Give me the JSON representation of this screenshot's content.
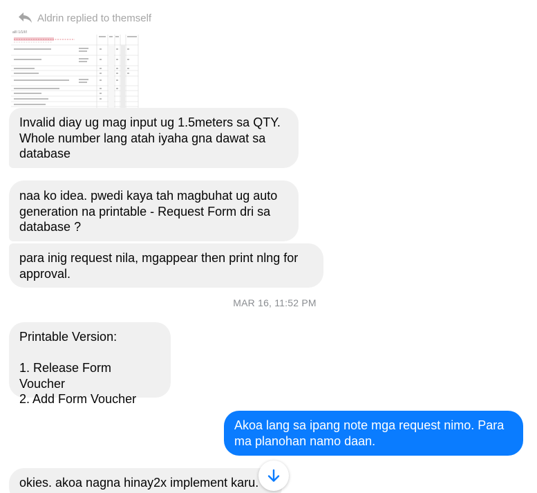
{
  "reply_header": {
    "text": "Aldrin replied to themself",
    "icon": "reply-icon"
  },
  "attachment": {
    "type": "spreadsheet-screenshot",
    "title": "aIII 1/1/I/I"
  },
  "messages": [
    {
      "direction": "incoming",
      "text": "Invalid diay ug mag input ug 1.5meters sa QTY.\nWhole number lang atah iyaha gna dawat sa\ndatabase"
    },
    {
      "direction": "incoming",
      "text": "naa ko idea. pwedi kaya tah magbuhat ug auto\ngeneration na printable - Request Form dri sa\ndatabase ?"
    },
    {
      "direction": "incoming",
      "text": "para inig request nila, mgappear then print nlng for\napproval."
    },
    {
      "direction": "incoming",
      "text": "Printable Version:\n\n1. Release Form Voucher\n2. Add Form Voucher"
    },
    {
      "direction": "outgoing",
      "text": "Akoa lang sa ipang note mga request nimo. Para\nma planohan namo daan."
    },
    {
      "direction": "incoming",
      "text": "okies. akoa nagna hinay2x implement karu."
    }
  ],
  "timestamp": "MAR 16, 11:52 PM",
  "scroll_down_icon": "arrow-down-icon",
  "colors": {
    "incoming_bubble": "#f0f0f0",
    "outgoing_bubble": "#0a7cff",
    "accent": "#0a7cff"
  }
}
